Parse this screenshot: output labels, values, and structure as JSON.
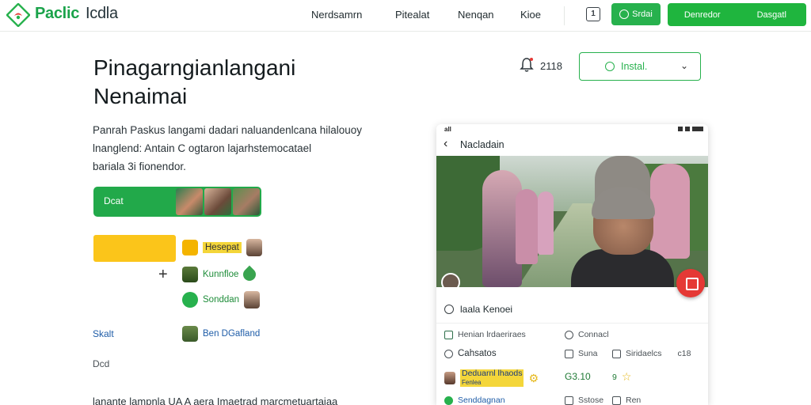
{
  "brand": {
    "name_1": "Paclic",
    "name_2": "Icdla",
    "accent": "#27b14d"
  },
  "nav": {
    "links": [
      "Nerdsamrn",
      "Pitealat",
      "Nenqan",
      "Kioe"
    ],
    "grid_icon_label": "1",
    "pill_label": "Srdai",
    "split_left": "Denredor",
    "split_right": "Dasgatl"
  },
  "hero": {
    "title_line1": "Pinagarngianlangani",
    "title_line2": "Nenaimai",
    "desc_line1": "Panrah Paskus langami dadari naluandenlcana hilalouoy",
    "desc_line2": "lnanglend: Antain C ogtaron lajarhstemocatael",
    "desc_line3": "bariala 3i fionendor.",
    "cta_label": "Dcat"
  },
  "features": {
    "item1": "Hesepat",
    "item2": "Kunnfloe",
    "item3": "Sonddan",
    "item4": "Ben DGafland",
    "plus": "+"
  },
  "side": {
    "label1": "Skalt",
    "label2": "Dcd",
    "bottom": "lanante lampnla UA A aera Imaetrad marcmetuartaiaa"
  },
  "controls": {
    "bell_count": "2118",
    "install_label": "Instal.",
    "install_chevron": "⌄"
  },
  "phone": {
    "status_time": "all",
    "back": "‹",
    "title": "Nacladain",
    "info_title": "laala Kenoei",
    "rows": {
      "r1_left": "Henian lrdaeriraes",
      "r1_right": "Connacl",
      "r2_left": "Cahsatos",
      "r2_mid": "Suna",
      "r2_right": "Siridaelcs",
      "r2_num": "c18",
      "r3_left_a": "Deduarnl lhaods",
      "r3_left_b": "Fenlea ",
      "r3_val": "G3.10",
      "r3_star_num": "9",
      "r4_left": "Senddagnan",
      "r4_mid": "Sstose",
      "r4_right": "Ren"
    }
  }
}
